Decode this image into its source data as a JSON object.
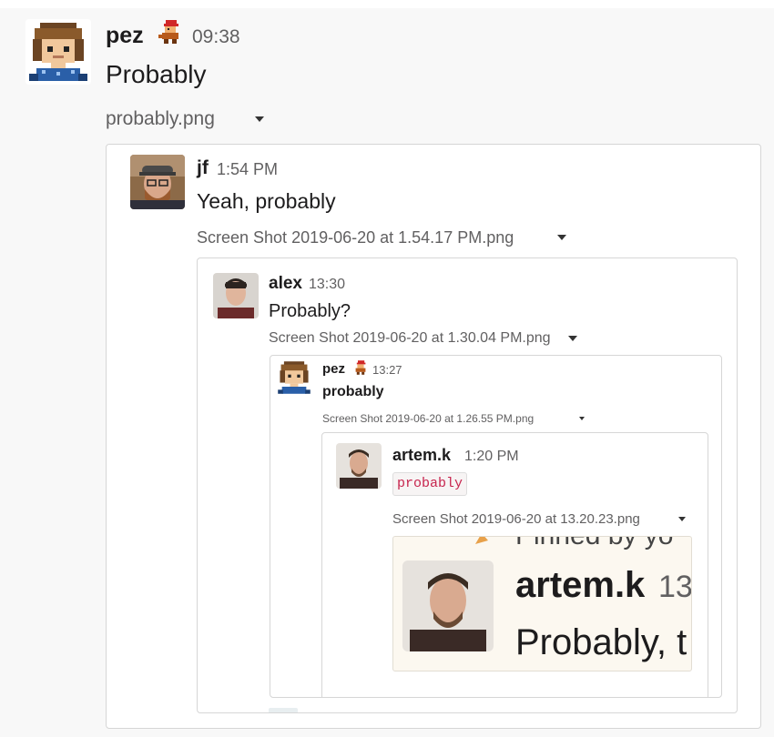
{
  "level1": {
    "author": "pez",
    "time": "09:38",
    "text": "Probably",
    "attachment": "probably.png",
    "avatar_icon": "pixel-person-avatar",
    "status_icon": "mario-raccoon-status-icon"
  },
  "level2": {
    "author": "jf",
    "time": "1:54 PM",
    "text": "Yeah, probably",
    "attachment": "Screen Shot 2019-06-20 at 1.54.17 PM.png"
  },
  "level3": {
    "author": "alex",
    "time": "13:30",
    "text": "Probably?",
    "attachment": "Screen Shot 2019-06-20 at 1.30.04 PM.png"
  },
  "level4": {
    "author": "pez",
    "time": "13:27",
    "text": "probably",
    "attachment": "Screen Shot 2019-06-20 at 1.26.55 PM.png"
  },
  "level5": {
    "author": "artem.k",
    "time": "1:20 PM",
    "code_text": "probably",
    "attachment": "Screen Shot 2019-06-20 at 13.20.23.png"
  },
  "level6": {
    "pinned_text": "Pinned by yo",
    "author": "artem.k",
    "time": "13",
    "text": "Probably, t"
  },
  "colors": {
    "background": "#f8f8f8",
    "card_border": "#d6d6d6",
    "code_text": "#c7254e",
    "code_background": "#f7f4f4",
    "preview_background": "#fcf8f0"
  }
}
